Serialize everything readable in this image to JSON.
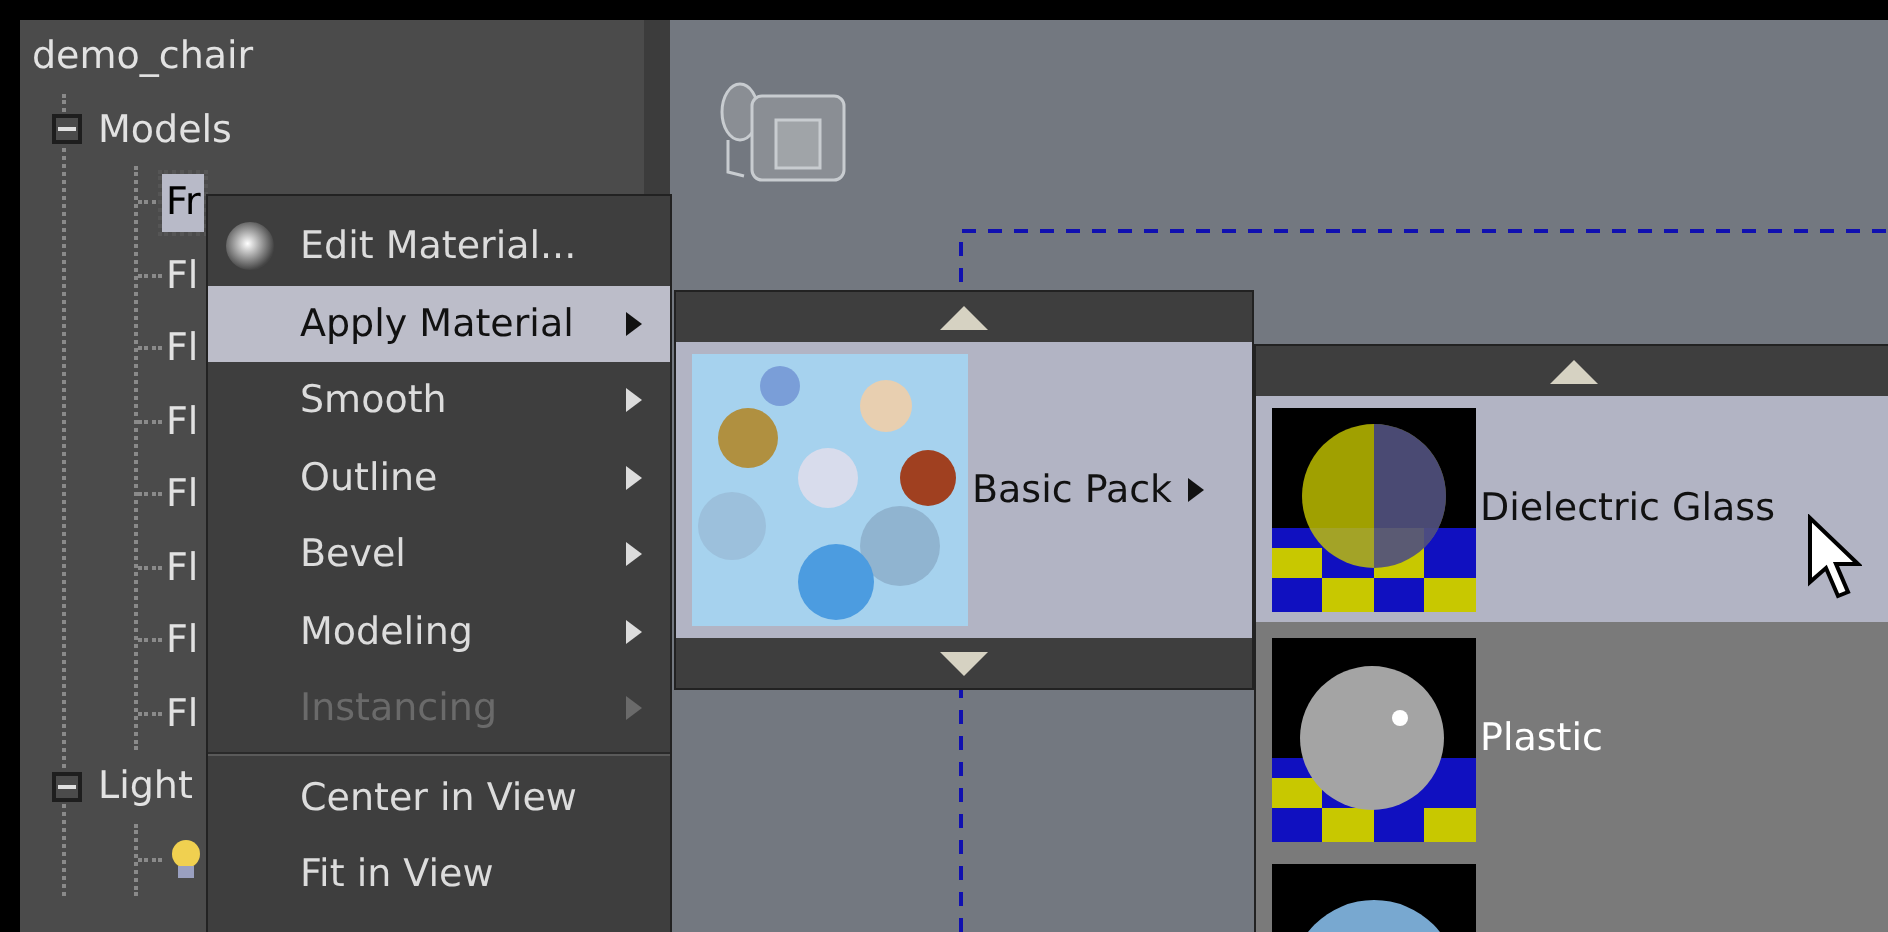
{
  "tree": {
    "root": "demo_chair",
    "children": [
      {
        "label": "Models",
        "expanded": true,
        "children": [
          {
            "kind": "text",
            "label": "Fr",
            "selected": true
          },
          {
            "kind": "text",
            "label": "Fl",
            "selected": false
          },
          {
            "kind": "text",
            "label": "Fl",
            "selected": false
          },
          {
            "kind": "text",
            "label": "Fl",
            "selected": false
          },
          {
            "kind": "text",
            "label": "Fl",
            "selected": false
          },
          {
            "kind": "text",
            "label": "Fl",
            "selected": false
          },
          {
            "kind": "text",
            "label": "Fl",
            "selected": false
          },
          {
            "kind": "text",
            "label": "Fl",
            "selected": false
          }
        ]
      },
      {
        "label": "Light",
        "expanded": true,
        "children": [
          {
            "kind": "light",
            "selected": false
          }
        ]
      }
    ]
  },
  "context_menu": [
    {
      "kind": "icon_item",
      "label": "Edit Material...",
      "selected": false,
      "disabled": false,
      "submenu": false
    },
    {
      "kind": "item",
      "label": "Apply Material",
      "selected": true,
      "disabled": false,
      "submenu": true
    },
    {
      "kind": "item",
      "label": "Smooth",
      "selected": false,
      "disabled": false,
      "submenu": true
    },
    {
      "kind": "item",
      "label": "Outline",
      "selected": false,
      "disabled": false,
      "submenu": true
    },
    {
      "kind": "item",
      "label": "Bevel",
      "selected": false,
      "disabled": false,
      "submenu": true
    },
    {
      "kind": "item",
      "label": "Modeling",
      "selected": false,
      "disabled": false,
      "submenu": true
    },
    {
      "kind": "item",
      "label": "Instancing",
      "selected": false,
      "disabled": true,
      "submenu": true
    },
    {
      "kind": "separator"
    },
    {
      "kind": "item",
      "label": "Center in View",
      "selected": false,
      "disabled": false,
      "submenu": false
    },
    {
      "kind": "item",
      "label": "Fit in View",
      "selected": false,
      "disabled": false,
      "submenu": false
    }
  ],
  "material_packs": [
    {
      "label": "Basic Pack",
      "selected": true,
      "submenu": true
    }
  ],
  "materials": [
    {
      "kind": "glass",
      "label": "Dielectric Glass",
      "selected": true
    },
    {
      "kind": "plastic",
      "label": "Plastic",
      "selected": false
    },
    {
      "kind": "matte",
      "selected": false
    }
  ]
}
